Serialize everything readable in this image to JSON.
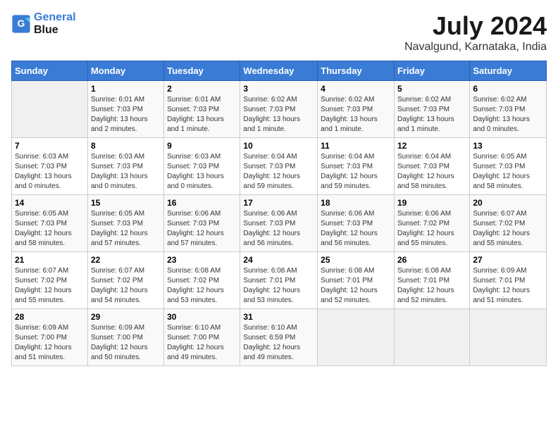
{
  "header": {
    "logo_line1": "General",
    "logo_line2": "Blue",
    "main_title": "July 2024",
    "subtitle": "Navalgund, Karnataka, India"
  },
  "days_of_week": [
    "Sunday",
    "Monday",
    "Tuesday",
    "Wednesday",
    "Thursday",
    "Friday",
    "Saturday"
  ],
  "weeks": [
    [
      {
        "day": "",
        "info": ""
      },
      {
        "day": "1",
        "info": "Sunrise: 6:01 AM\nSunset: 7:03 PM\nDaylight: 13 hours\nand 2 minutes."
      },
      {
        "day": "2",
        "info": "Sunrise: 6:01 AM\nSunset: 7:03 PM\nDaylight: 13 hours\nand 1 minute."
      },
      {
        "day": "3",
        "info": "Sunrise: 6:02 AM\nSunset: 7:03 PM\nDaylight: 13 hours\nand 1 minute."
      },
      {
        "day": "4",
        "info": "Sunrise: 6:02 AM\nSunset: 7:03 PM\nDaylight: 13 hours\nand 1 minute."
      },
      {
        "day": "5",
        "info": "Sunrise: 6:02 AM\nSunset: 7:03 PM\nDaylight: 13 hours\nand 1 minute."
      },
      {
        "day": "6",
        "info": "Sunrise: 6:02 AM\nSunset: 7:03 PM\nDaylight: 13 hours\nand 0 minutes."
      }
    ],
    [
      {
        "day": "7",
        "info": "Sunrise: 6:03 AM\nSunset: 7:03 PM\nDaylight: 13 hours\nand 0 minutes."
      },
      {
        "day": "8",
        "info": "Sunrise: 6:03 AM\nSunset: 7:03 PM\nDaylight: 13 hours\nand 0 minutes."
      },
      {
        "day": "9",
        "info": "Sunrise: 6:03 AM\nSunset: 7:03 PM\nDaylight: 13 hours\nand 0 minutes."
      },
      {
        "day": "10",
        "info": "Sunrise: 6:04 AM\nSunset: 7:03 PM\nDaylight: 12 hours\nand 59 minutes."
      },
      {
        "day": "11",
        "info": "Sunrise: 6:04 AM\nSunset: 7:03 PM\nDaylight: 12 hours\nand 59 minutes."
      },
      {
        "day": "12",
        "info": "Sunrise: 6:04 AM\nSunset: 7:03 PM\nDaylight: 12 hours\nand 58 minutes."
      },
      {
        "day": "13",
        "info": "Sunrise: 6:05 AM\nSunset: 7:03 PM\nDaylight: 12 hours\nand 58 minutes."
      }
    ],
    [
      {
        "day": "14",
        "info": "Sunrise: 6:05 AM\nSunset: 7:03 PM\nDaylight: 12 hours\nand 58 minutes."
      },
      {
        "day": "15",
        "info": "Sunrise: 6:05 AM\nSunset: 7:03 PM\nDaylight: 12 hours\nand 57 minutes."
      },
      {
        "day": "16",
        "info": "Sunrise: 6:06 AM\nSunset: 7:03 PM\nDaylight: 12 hours\nand 57 minutes."
      },
      {
        "day": "17",
        "info": "Sunrise: 6:06 AM\nSunset: 7:03 PM\nDaylight: 12 hours\nand 56 minutes."
      },
      {
        "day": "18",
        "info": "Sunrise: 6:06 AM\nSunset: 7:03 PM\nDaylight: 12 hours\nand 56 minutes."
      },
      {
        "day": "19",
        "info": "Sunrise: 6:06 AM\nSunset: 7:02 PM\nDaylight: 12 hours\nand 55 minutes."
      },
      {
        "day": "20",
        "info": "Sunrise: 6:07 AM\nSunset: 7:02 PM\nDaylight: 12 hours\nand 55 minutes."
      }
    ],
    [
      {
        "day": "21",
        "info": "Sunrise: 6:07 AM\nSunset: 7:02 PM\nDaylight: 12 hours\nand 55 minutes."
      },
      {
        "day": "22",
        "info": "Sunrise: 6:07 AM\nSunset: 7:02 PM\nDaylight: 12 hours\nand 54 minutes."
      },
      {
        "day": "23",
        "info": "Sunrise: 6:08 AM\nSunset: 7:02 PM\nDaylight: 12 hours\nand 53 minutes."
      },
      {
        "day": "24",
        "info": "Sunrise: 6:08 AM\nSunset: 7:01 PM\nDaylight: 12 hours\nand 53 minutes."
      },
      {
        "day": "25",
        "info": "Sunrise: 6:08 AM\nSunset: 7:01 PM\nDaylight: 12 hours\nand 52 minutes."
      },
      {
        "day": "26",
        "info": "Sunrise: 6:08 AM\nSunset: 7:01 PM\nDaylight: 12 hours\nand 52 minutes."
      },
      {
        "day": "27",
        "info": "Sunrise: 6:09 AM\nSunset: 7:01 PM\nDaylight: 12 hours\nand 51 minutes."
      }
    ],
    [
      {
        "day": "28",
        "info": "Sunrise: 6:09 AM\nSunset: 7:00 PM\nDaylight: 12 hours\nand 51 minutes."
      },
      {
        "day": "29",
        "info": "Sunrise: 6:09 AM\nSunset: 7:00 PM\nDaylight: 12 hours\nand 50 minutes."
      },
      {
        "day": "30",
        "info": "Sunrise: 6:10 AM\nSunset: 7:00 PM\nDaylight: 12 hours\nand 49 minutes."
      },
      {
        "day": "31",
        "info": "Sunrise: 6:10 AM\nSunset: 6:59 PM\nDaylight: 12 hours\nand 49 minutes."
      },
      {
        "day": "",
        "info": ""
      },
      {
        "day": "",
        "info": ""
      },
      {
        "day": "",
        "info": ""
      }
    ]
  ]
}
